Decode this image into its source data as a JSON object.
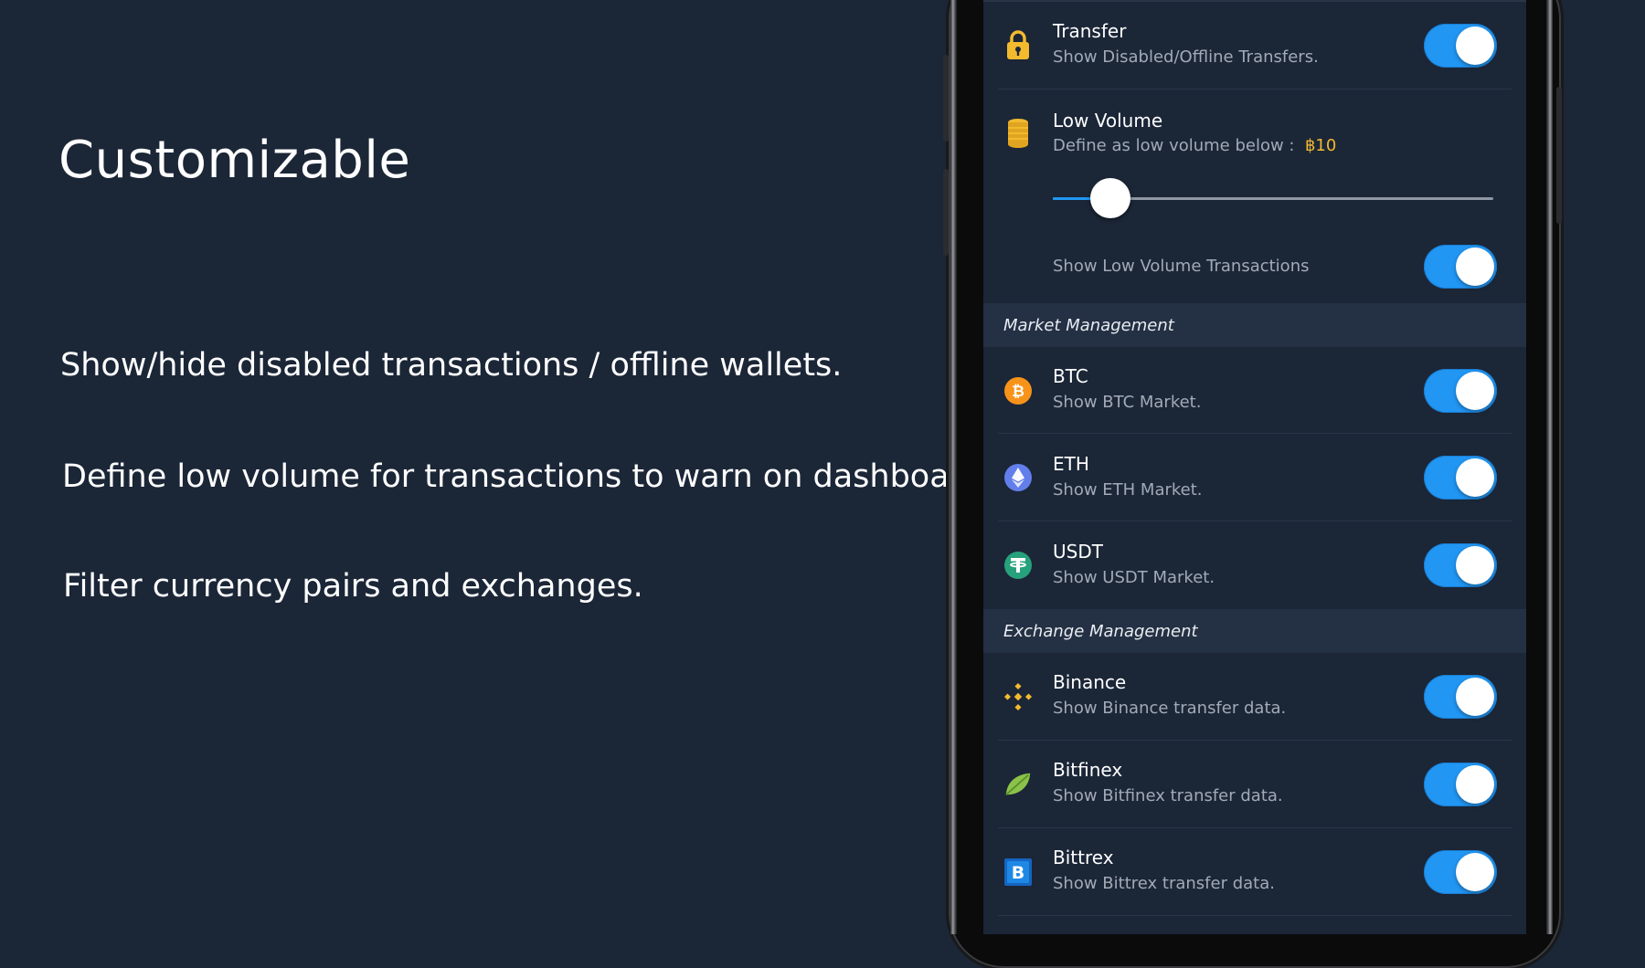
{
  "promo": {
    "title": "Customizable",
    "features": [
      "Show/hide disabled transactions / offline wallets.",
      "Define low volume for transactions to warn on dashboard.",
      "Filter currency pairs and exchanges."
    ]
  },
  "settings": {
    "transfer": {
      "title": "Transfer",
      "subtitle": "Show Disabled/Offline Transfers.",
      "icon": "lock-icon",
      "enabled": true
    },
    "low_volume": {
      "title": "Low Volume",
      "subtitle_prefix": "Define as low volume below :",
      "value": "฿10",
      "icon": "coins-icon",
      "slider_level_percent": 13,
      "show_label": "Show Low Volume Transactions",
      "show_enabled": true
    },
    "market_section": {
      "header": "Market Management",
      "items": [
        {
          "title": "BTC",
          "subtitle": "Show BTC Market.",
          "icon": "bitcoin-icon",
          "enabled": true
        },
        {
          "title": "ETH",
          "subtitle": "Show ETH Market.",
          "icon": "ethereum-icon",
          "enabled": true
        },
        {
          "title": "USDT",
          "subtitle": "Show USDT Market.",
          "icon": "tether-icon",
          "enabled": true
        }
      ]
    },
    "exchange_section": {
      "header": "Exchange Management",
      "items": [
        {
          "title": "Binance",
          "subtitle": "Show Binance transfer data.",
          "icon": "binance-icon",
          "enabled": true
        },
        {
          "title": "Bitfinex",
          "subtitle": "Show Bitfinex transfer data.",
          "icon": "bitfinex-icon",
          "enabled": true
        },
        {
          "title": "Bittrex",
          "subtitle": "Show Bittrex transfer data.",
          "icon": "bittrex-icon",
          "enabled": true
        }
      ]
    }
  },
  "colors": {
    "background": "#1b2637",
    "section_header": "#243043",
    "toggle_on": "#2196f3",
    "accent_value": "#f3ba2f",
    "subtitle": "#a3aab6"
  }
}
